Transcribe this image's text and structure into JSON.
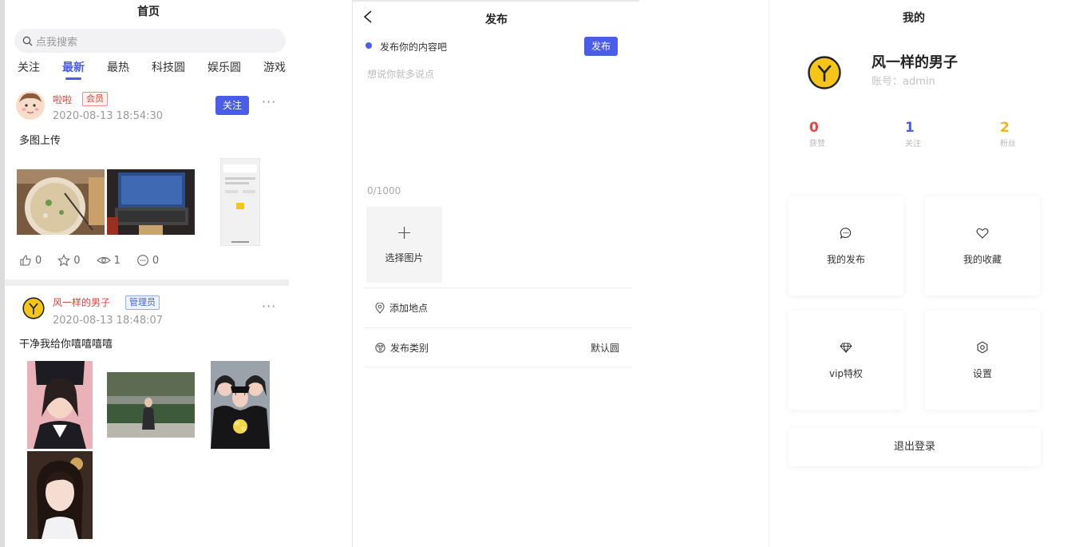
{
  "home": {
    "title": "首页",
    "search_placeholder": "点我搜索",
    "tabs": [
      "关注",
      "最新",
      "最热",
      "科技圆",
      "娱乐圆",
      "游戏"
    ],
    "active_tab": "最新",
    "posts": [
      {
        "user": "啦啦",
        "badge": "会员",
        "time": "2020-08-13 18:54:30",
        "follow_label": "关注",
        "text": "多图上传",
        "likes": "0",
        "stars": "0",
        "views": "1",
        "comments": "0"
      },
      {
        "user": "风一样的男子",
        "badge": "管理员",
        "time": "2020-08-13 18:48:07",
        "text": "干净我给你嘻嘻嘻嘻"
      }
    ]
  },
  "publish": {
    "title": "发布",
    "prompt": "发布你的内容吧",
    "submit_label": "发布",
    "placeholder": "想说你就多说点",
    "char_count": "0/1000",
    "choose_image_label": "选择图片",
    "location_label": "添加地点",
    "category_label": "发布类别",
    "category_value": "默认圆"
  },
  "mine": {
    "title": "我的",
    "name": "风一样的男子",
    "account": "账号：admin",
    "stats": [
      {
        "value": "0",
        "label": "获赞",
        "color": "#e8453c"
      },
      {
        "value": "1",
        "label": "关注",
        "color": "#4a5de8"
      },
      {
        "value": "2",
        "label": "粉丝",
        "color": "#f2b61b"
      }
    ],
    "cards": [
      {
        "label": "我的发布",
        "icon": "chat-bubble-icon"
      },
      {
        "label": "我的收藏",
        "icon": "heart-icon"
      },
      {
        "label": "vip特权",
        "icon": "diamond-icon"
      },
      {
        "label": "设置",
        "icon": "settings-icon"
      }
    ],
    "logout_label": "退出登录"
  },
  "colors": {
    "accent": "#4a5de8",
    "red": "#e0413b",
    "avatar_yellow": "#f5c518"
  }
}
